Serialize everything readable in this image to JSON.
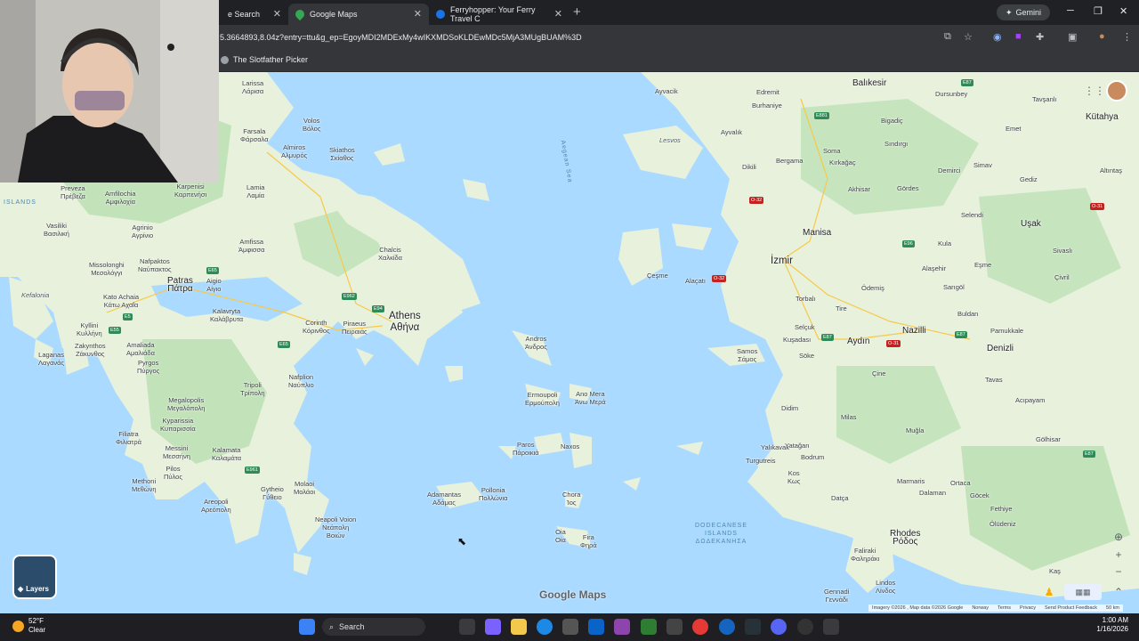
{
  "browser": {
    "tabs": [
      {
        "label": "e Search",
        "active": false
      },
      {
        "label": "Google Maps",
        "active": true
      },
      {
        "label": "Ferryhopper: Your Ferry Travel C",
        "active": false
      }
    ],
    "new_tab_symbol": "+",
    "gemini_label": "Gemini",
    "url": "5.3664893,8.04z?entry=ttu&g_ep=EgoyMDI2MDExMy4wIKXMDSoKLDEwMDc5MjA3MUgBUAM%3D",
    "bookmark": "The Slotfather Picker"
  },
  "map": {
    "google_logo": "Google Maps",
    "layers_label": "Layers",
    "labels": [
      {
        "text": "Larissa\nΛάρισα"
      },
      {
        "text": "Volos\nΒόλος"
      },
      {
        "text": "Farsala\nΦάρσαλα"
      },
      {
        "text": "Almiros\nΑλμυρός"
      },
      {
        "text": "Skiathos\nΣκίαθος"
      },
      {
        "text": "Lamia\nΛαμία"
      },
      {
        "text": "Karpenisi\nΚαρπενήσι"
      },
      {
        "text": "Preveza\nΠρέβεζα"
      },
      {
        "text": "Amfilochia\nΑμφιλοχία"
      },
      {
        "text": "Agrinio\nΑγρίνιο"
      },
      {
        "text": "Vasiliki\nΒασιλική"
      },
      {
        "text": "Amfissa\nΆμφισσα"
      },
      {
        "text": "Nafpaktos\nΝαύπακτος"
      },
      {
        "text": "Missolonghi\nΜεσολόγγι"
      },
      {
        "text": "Patras\nΠάτρα"
      },
      {
        "text": "Aigio\nΑίγιο"
      },
      {
        "text": "Kefalonia"
      },
      {
        "text": "Kato Achaia\nΚάτω Αχαΐα"
      },
      {
        "text": "Kalavryta\nΚαλάβρυτα"
      },
      {
        "text": "Corinth\nΚόρινθος"
      },
      {
        "text": "Piraeus\nΠειραιάς"
      },
      {
        "text": "Chalcis\nΧαλκίδα"
      },
      {
        "text": "Kyllini\nΚυλλήνη"
      },
      {
        "text": "Zakynthos\nΖάκυνθος"
      },
      {
        "text": "Amaliada\nΑμαλιάδα"
      },
      {
        "text": "Pyrgos\nΠύργος"
      },
      {
        "text": "Laganas\nΛαγανάς"
      },
      {
        "text": "Nafplion\nΝαύπλιο"
      },
      {
        "text": "Tripoli\nΤρίπολη"
      },
      {
        "text": "Megalopolis\nΜεγαλόπολη"
      },
      {
        "text": "Kyparissia\nΚυπαρισσία"
      },
      {
        "text": "Filiatra\nΦιλιατρά"
      },
      {
        "text": "Messini\nΜεσσήνη"
      },
      {
        "text": "Kalamata\nΚαλαμάτα"
      },
      {
        "text": "Pilos\nΠύλος"
      },
      {
        "text": "Methoni\nΜεθώνη"
      },
      {
        "text": "Gytheio\nΓύθειο"
      },
      {
        "text": "Areopoli\nΑρεόπολη"
      },
      {
        "text": "Molaoi\nΜολάοι"
      },
      {
        "text": "Neapoli Voion\nΝεάπολη\nΒοιών"
      },
      {
        "text": "Andros\nΆνδρος"
      },
      {
        "text": "Ermoupoli\nΕρμούπολη"
      },
      {
        "text": "Ano Mera\nΆνω Μερά"
      },
      {
        "text": "Paros\nΠάροικιά"
      },
      {
        "text": "Naxos"
      },
      {
        "text": "Adamantas\nΑδάμας"
      },
      {
        "text": "Pollonia\nΠολλώνια"
      },
      {
        "text": "Chora\nΊος"
      },
      {
        "text": "Oia\nΟία"
      },
      {
        "text": "Fira\nΦηρά"
      },
      {
        "text": "Ayvacik"
      },
      {
        "text": "Edremit"
      },
      {
        "text": "Burhaniye"
      },
      {
        "text": "Balıkesir"
      },
      {
        "text": "Dursunbey"
      },
      {
        "text": "Tavşanlı"
      },
      {
        "text": "Kütahya"
      },
      {
        "text": "Bigadiç"
      },
      {
        "text": "Emet"
      },
      {
        "text": "Lesvos"
      },
      {
        "text": "Ayvalık"
      },
      {
        "text": "Sındırgı"
      },
      {
        "text": "Dikili"
      },
      {
        "text": "Bergama"
      },
      {
        "text": "Soma"
      },
      {
        "text": "Kırkağaç"
      },
      {
        "text": "Akhisar"
      },
      {
        "text": "Gördes"
      },
      {
        "text": "Demirci"
      },
      {
        "text": "Simav"
      },
      {
        "text": "Gediz"
      },
      {
        "text": "Altıntaş"
      },
      {
        "text": "Selendi"
      },
      {
        "text": "Uşak"
      },
      {
        "text": "Manisa"
      },
      {
        "text": "İzmir"
      },
      {
        "text": "Kula"
      },
      {
        "text": "Alaşehir"
      },
      {
        "text": "Eşme"
      },
      {
        "text": "Sivaslı"
      },
      {
        "text": "Çeşme"
      },
      {
        "text": "Alaçatı"
      },
      {
        "text": "Torbalı"
      },
      {
        "text": "Ödemiş"
      },
      {
        "text": "Sarıgöl"
      },
      {
        "text": "Çivril"
      },
      {
        "text": "Tire"
      },
      {
        "text": "Buldan"
      },
      {
        "text": "Selçuk"
      },
      {
        "text": "Kuşadası"
      },
      {
        "text": "Aydın"
      },
      {
        "text": "Nazilli"
      },
      {
        "text": "Pamukkale"
      },
      {
        "text": "Denizli"
      },
      {
        "text": "Samos\nΣάμος"
      },
      {
        "text": "Söke"
      },
      {
        "text": "Çine"
      },
      {
        "text": "Tavas"
      },
      {
        "text": "Acıpayam"
      },
      {
        "text": "Didim"
      },
      {
        "text": "Milas"
      },
      {
        "text": "Muğla"
      },
      {
        "text": "Yatağan"
      },
      {
        "text": "Yalıkavak"
      },
      {
        "text": "Bodrum"
      },
      {
        "text": "Turgutreis"
      },
      {
        "text": "Kos\nΚως"
      },
      {
        "text": "Gölhisar"
      },
      {
        "text": "Marmaris"
      },
      {
        "text": "Dalaman"
      },
      {
        "text": "Ortaca"
      },
      {
        "text": "Göcek"
      },
      {
        "text": "Fethiye"
      },
      {
        "text": "Datça"
      },
      {
        "text": "Ölüdeniz"
      },
      {
        "text": "Rhodes\nΡόδος"
      },
      {
        "text": "Faliraki\nΦαληράκι"
      },
      {
        "text": "Lindos\nΛίνδος"
      },
      {
        "text": "Gennadi\nΓεννάδι"
      },
      {
        "text": "Kaş"
      },
      {
        "text": "Aegean Sea"
      },
      {
        "text": "ISLANDS"
      },
      {
        "text": "DODECANESE\nISLANDS\nΔΩΔΕΚΑΝΗΣΑ"
      }
    ],
    "capital": {
      "name": "Athens",
      "local": "Αθήνα"
    },
    "roads": [
      "E65",
      "E65",
      "E962",
      "E94",
      "E5",
      "E55",
      "E961",
      "E881",
      "E87",
      "E96",
      "E87",
      "E87",
      "E87",
      "O-32",
      "O-32",
      "O-31",
      "O-31"
    ],
    "attribution": [
      "Imagery ©2026 , Map data ©2026 Google",
      "Norway",
      "Terms",
      "Privacy",
      "Send Product Feedback",
      "50 km"
    ]
  },
  "taskbar": {
    "weather_temp": "52°F",
    "weather_cond": "Clear",
    "search_label": "Search",
    "time": "1:00 AM",
    "date": "1/16/2026"
  },
  "colors": {
    "water": "#aadaff",
    "land": "#e8f1dc",
    "green": "#b8e0b0",
    "chrome": "#202124",
    "toolbar": "#35363a"
  }
}
